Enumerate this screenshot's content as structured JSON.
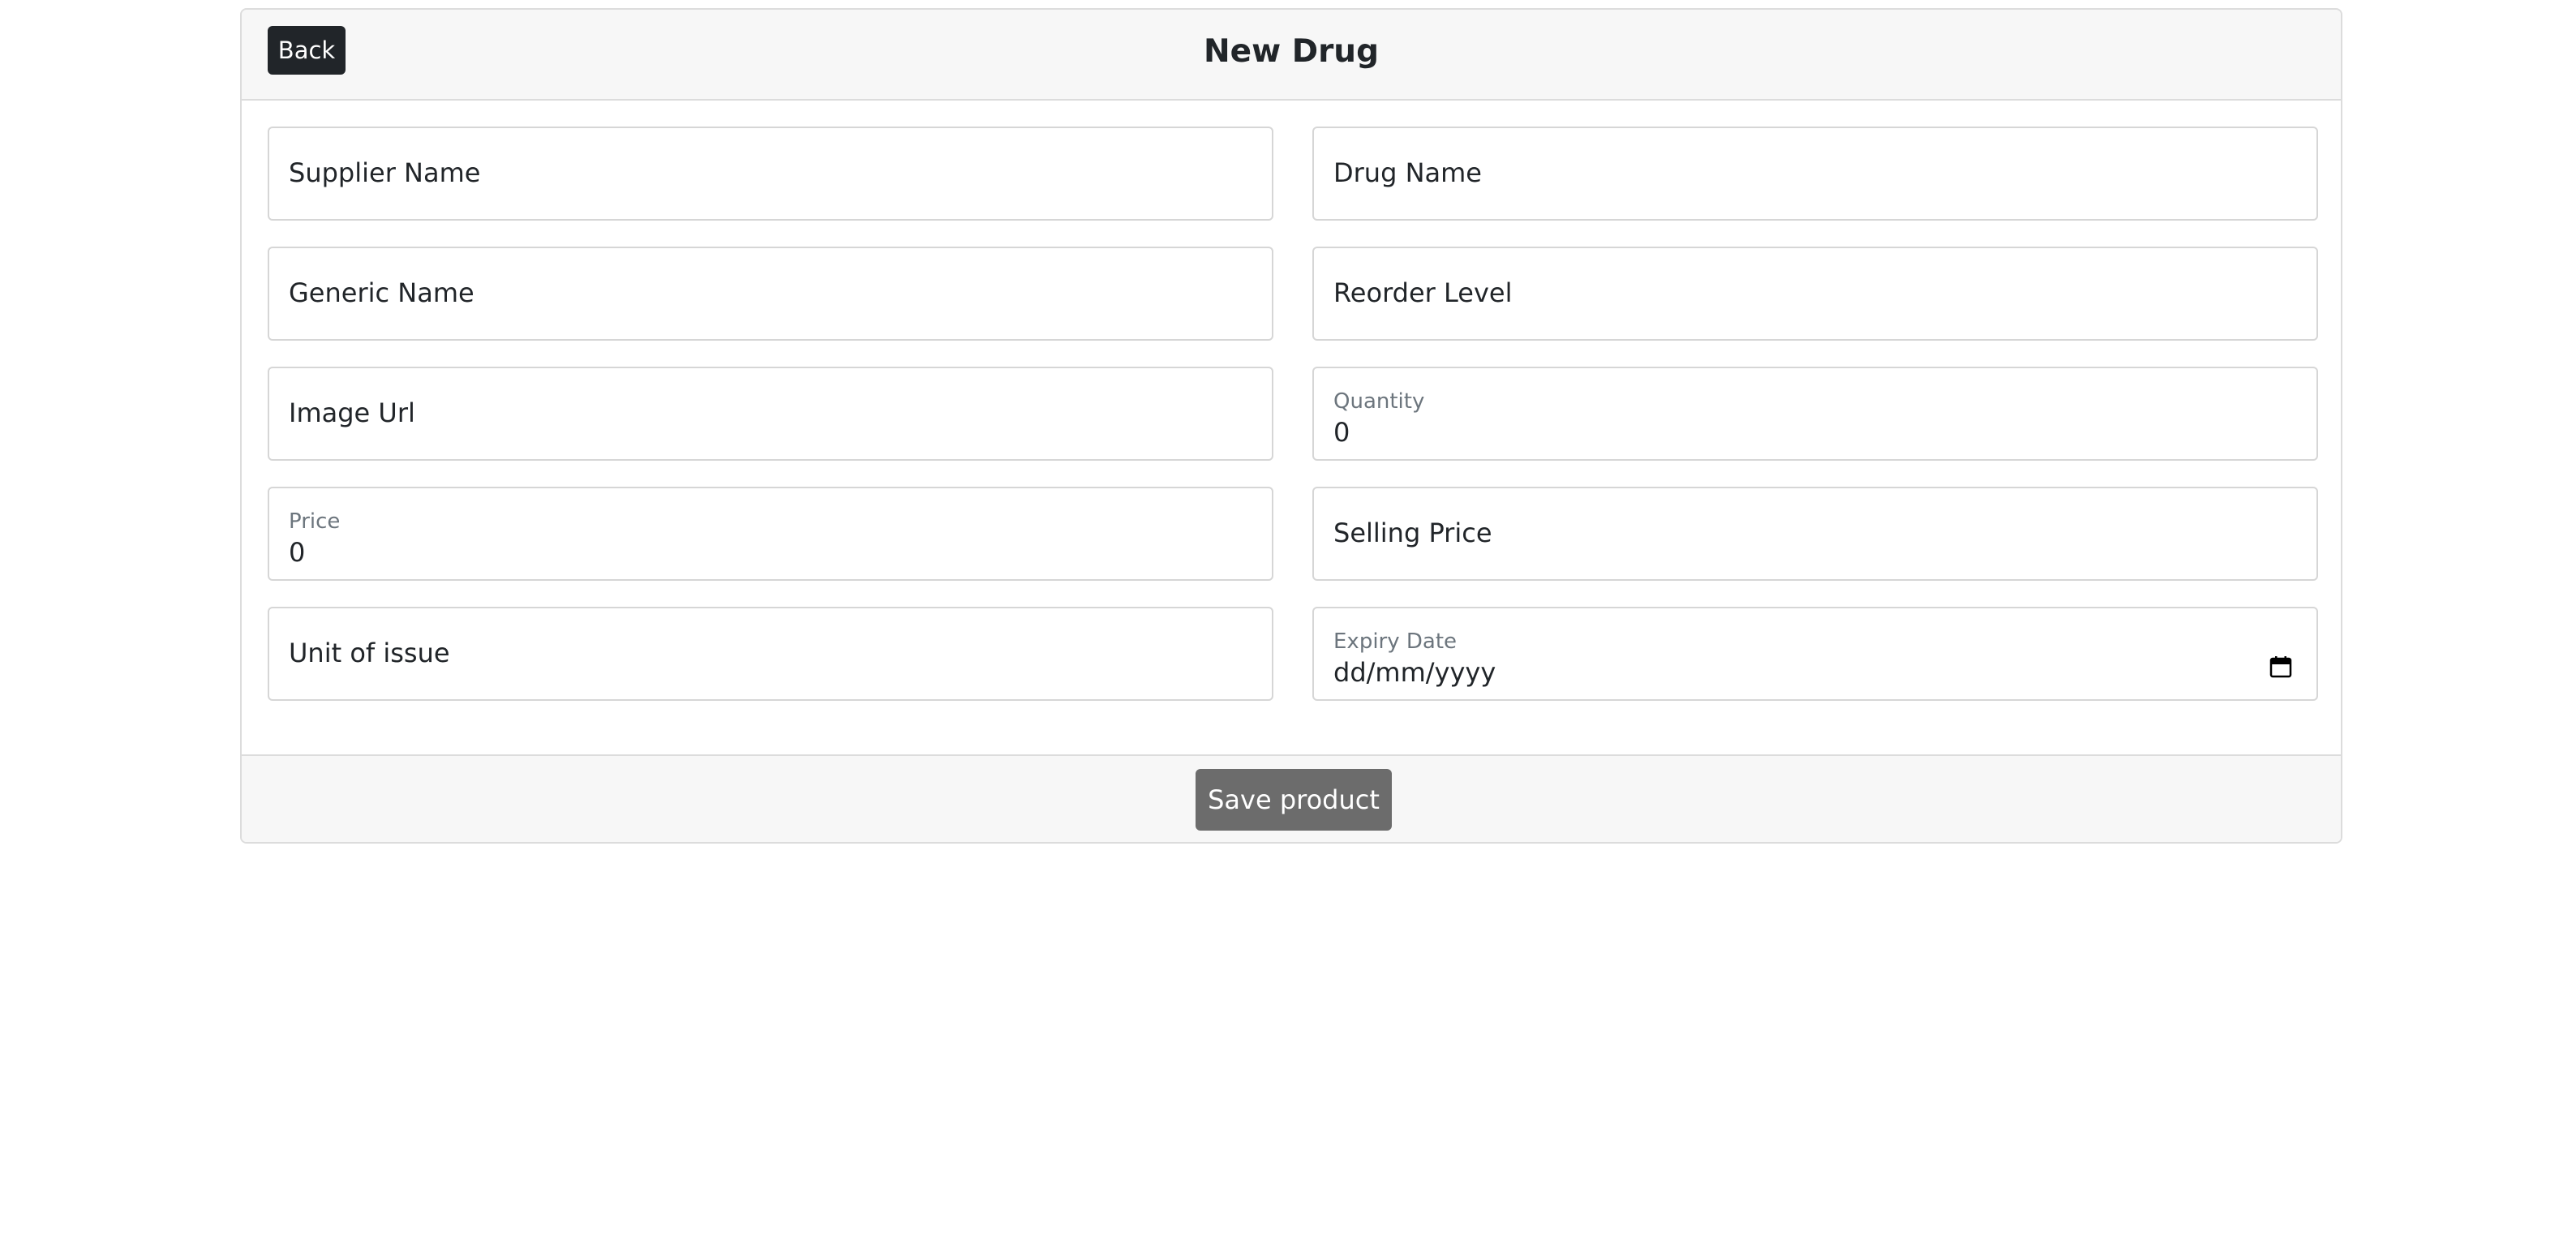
{
  "header": {
    "back_label": "Back",
    "title": "New Drug"
  },
  "form": {
    "supplier_name": {
      "placeholder": "Supplier Name"
    },
    "drug_name": {
      "placeholder": "Drug Name"
    },
    "generic_name": {
      "placeholder": "Generic Name"
    },
    "reorder_level": {
      "placeholder": "Reorder Level"
    },
    "image_url": {
      "placeholder": "Image Url"
    },
    "quantity": {
      "label": "Quantity",
      "value": "0"
    },
    "price": {
      "label": "Price",
      "value": "0"
    },
    "selling_price": {
      "placeholder": "Selling Price"
    },
    "unit_of_issue": {
      "placeholder": "Unit of issue"
    },
    "expiry_date": {
      "label": "Expiry Date",
      "value": "dd/mm/yyyy",
      "icon": "calendar-icon"
    }
  },
  "footer": {
    "save_label": "Save product"
  },
  "colors": {
    "header_bg": "#f7f7f7",
    "back_button": "#212529",
    "save_button": "#6c6c6c",
    "border": "#dcdcdc"
  }
}
